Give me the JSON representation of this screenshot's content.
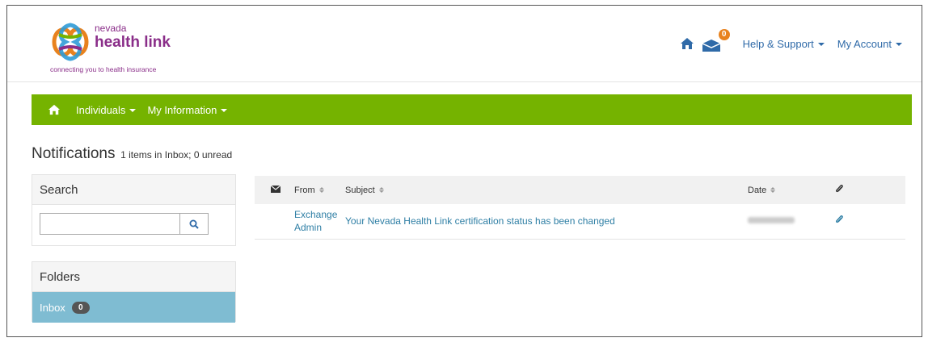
{
  "header": {
    "logo_line1": "nevada",
    "logo_line2": "health link",
    "logo_tagline": "connecting you to health insurance",
    "mail_count": "0",
    "help_label": "Help & Support",
    "account_label": "My Account",
    "icons": [
      "home-icon",
      "mail-icon"
    ]
  },
  "nav": {
    "items": [
      "Individuals",
      "My Information"
    ],
    "color": "#75b300"
  },
  "page": {
    "title": "Notifications",
    "subtitle": "1 items in Inbox; 0 unread"
  },
  "search": {
    "heading": "Search",
    "value": "",
    "placeholder": ""
  },
  "folders": {
    "heading": "Folders",
    "inbox_label": "Inbox",
    "inbox_count": "0"
  },
  "table": {
    "columns": {
      "from": "From",
      "subject": "Subject",
      "date": "Date"
    },
    "rows": [
      {
        "from_line1": "Exchange",
        "from_line2": "Admin",
        "subject": "Your Nevada Health Link certification status has been changed"
      }
    ]
  },
  "colors": {
    "accent_green": "#75b300",
    "inbox_blue": "#7fbcd2",
    "link_blue": "#2f7fa5",
    "badge_orange": "#e8821e"
  }
}
